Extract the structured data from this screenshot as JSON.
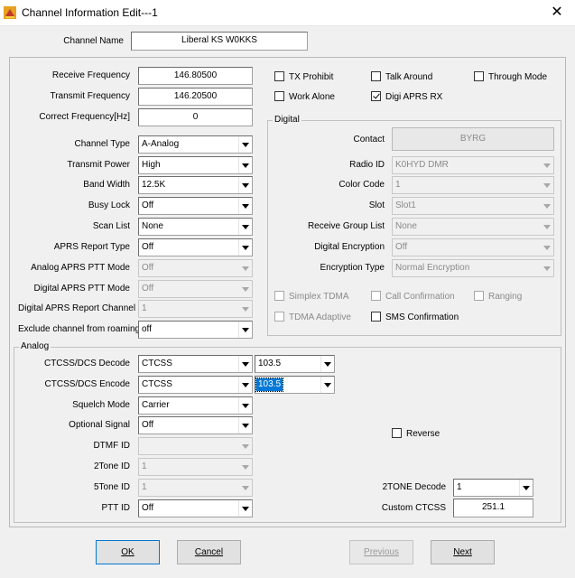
{
  "window": {
    "title": "Channel Information Edit---1"
  },
  "channel_name": {
    "label": "Channel Name",
    "value": "Liberal KS W0KKS"
  },
  "left": {
    "receive_frequency": {
      "label": "Receive Frequency",
      "value": "146.80500"
    },
    "transmit_frequency": {
      "label": "Transmit Frequency",
      "value": "146.20500"
    },
    "correct_frequency": {
      "label": "Correct Frequency[Hz]",
      "value": "0"
    },
    "channel_type": {
      "label": "Channel Type",
      "value": "A-Analog"
    },
    "transmit_power": {
      "label": "Transmit Power",
      "value": "High"
    },
    "band_width": {
      "label": "Band Width",
      "value": "12.5K"
    },
    "busy_lock": {
      "label": "Busy Lock",
      "value": "Off"
    },
    "scan_list": {
      "label": "Scan List",
      "value": "None"
    },
    "aprs_report_type": {
      "label": "APRS Report Type",
      "value": "Off"
    },
    "analog_aprs_ptt_mode": {
      "label": "Analog APRS PTT Mode",
      "value": "Off"
    },
    "digital_aprs_ptt_mode": {
      "label": "Digital APRS PTT Mode",
      "value": "Off"
    },
    "digital_aprs_report_channel": {
      "label": "Digital APRS Report Channel",
      "value": "1"
    },
    "exclude_roaming": {
      "label": "Exclude channel from roaming",
      "value": "off"
    }
  },
  "checks": {
    "tx_prohibit": {
      "label": "TX Prohibit",
      "checked": false
    },
    "talk_around": {
      "label": "Talk Around",
      "checked": false
    },
    "through_mode": {
      "label": "Through Mode",
      "checked": false
    },
    "work_alone": {
      "label": "Work Alone",
      "checked": false
    },
    "digi_aprs_rx": {
      "label": "Digi APRS RX",
      "checked": true
    }
  },
  "digital": {
    "title": "Digital",
    "contact": {
      "label": "Contact",
      "value": "BYRG"
    },
    "radio_id": {
      "label": "Radio ID",
      "value": "K0HYD DMR"
    },
    "color_code": {
      "label": "Color Code",
      "value": "1"
    },
    "slot": {
      "label": "Slot",
      "value": "Slot1"
    },
    "receive_group_list": {
      "label": "Receive Group List",
      "value": "None"
    },
    "digital_encryption": {
      "label": "Digital Encryption",
      "value": "Off"
    },
    "encryption_type": {
      "label": "Encryption Type",
      "value": "Normal Encryption"
    },
    "simplex_tdma": {
      "label": "Simplex TDMA",
      "checked": false
    },
    "call_confirmation": {
      "label": "Call Confirmation",
      "checked": false
    },
    "ranging": {
      "label": "Ranging",
      "checked": false
    },
    "tdma_adaptive": {
      "label": "TDMA Adaptive",
      "checked": false
    },
    "sms_confirmation": {
      "label": "SMS Confirmation",
      "checked": false
    }
  },
  "analog": {
    "title": "Analog",
    "ctcss_decode": {
      "label": "CTCSS/DCS Decode",
      "type": "CTCSS",
      "value": "103.5"
    },
    "ctcss_encode": {
      "label": "CTCSS/DCS Encode",
      "type": "CTCSS",
      "value": "103.5"
    },
    "squelch_mode": {
      "label": "Squelch Mode",
      "value": "Carrier"
    },
    "optional_signal": {
      "label": "Optional Signal",
      "value": "Off"
    },
    "dtmf_id": {
      "label": "DTMF ID",
      "value": ""
    },
    "two_tone_id": {
      "label": "2Tone ID",
      "value": "1"
    },
    "five_tone_id": {
      "label": "5Tone ID",
      "value": "1"
    },
    "ptt_id": {
      "label": "PTT ID",
      "value": "Off"
    },
    "reverse": {
      "label": "Reverse",
      "checked": false
    },
    "two_tone_decode": {
      "label": "2TONE Decode",
      "value": "1"
    },
    "custom_ctcss": {
      "label": "Custom CTCSS",
      "value": "251.1"
    }
  },
  "buttons": {
    "ok": {
      "label": "OK"
    },
    "cancel": {
      "label": "Cancel"
    },
    "previous": {
      "label": "Previous"
    },
    "next": {
      "label": "Next"
    }
  }
}
